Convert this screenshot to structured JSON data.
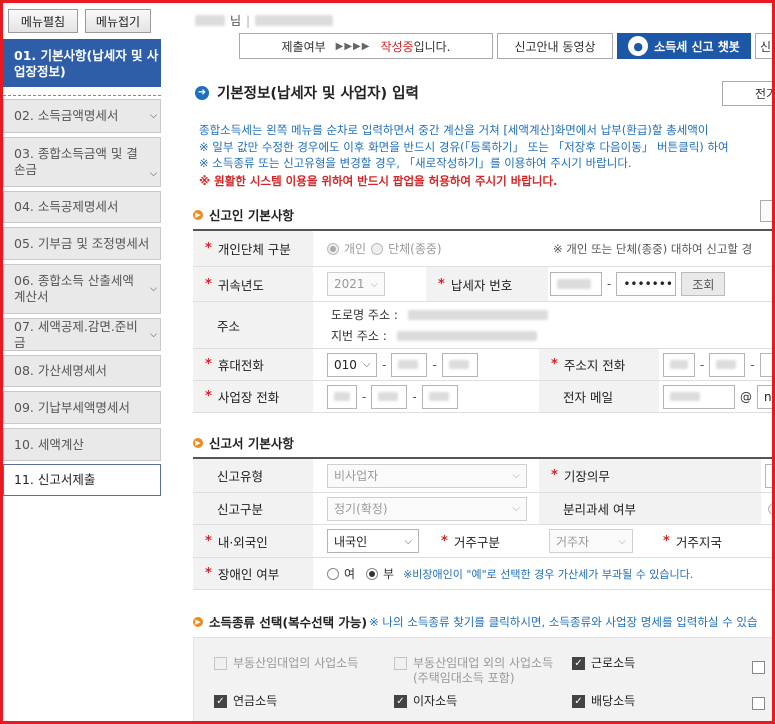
{
  "sidebar": {
    "expand_label": "메뉴펼침",
    "collapse_label": "메뉴접기",
    "items": [
      {
        "label": "01. 기본사항(납세자 및 사업장정보)"
      },
      {
        "label": "02. 소득금액명세서"
      },
      {
        "label": "03. 종합소득금액 및 결손금"
      },
      {
        "label": "04. 소득공제명세서"
      },
      {
        "label": "05. 기부금 및 조정명세서"
      },
      {
        "label": "06. 종합소득 산출세액계산서"
      },
      {
        "label": "07. 세액공제.감면.준비금"
      },
      {
        "label": "08. 가산세명세서"
      },
      {
        "label": "09. 기납부세액명세서"
      },
      {
        "label": "10. 세액계산"
      },
      {
        "label": "11. 신고서제출"
      }
    ]
  },
  "header": {
    "user_suffix": "님",
    "separator": "|",
    "status_label": "제출여부",
    "status_arrows": "▶▶▶▶",
    "status_value": "작성중",
    "status_suffix": "입니다.",
    "guide_video": "신고안내 동영상",
    "chatbot": "소득세 신고 챗봇",
    "extra_tab": "신"
  },
  "page": {
    "title": "기본정보(납세자 및 사업자) 입력",
    "btn_full": "전기"
  },
  "info": {
    "line1": "종합소득세는 왼쪽 메뉴를 순차로 입력하면서 중간 계산을 거쳐 [세액계산]화면에서 납부(환급)할 총세액이",
    "line2": "※ 일부 값만 수정한 경우에도 이후 화면을 반드시 경유(「등록하기」 또는 「저장후 다음이동」 버튼클릭) 하여",
    "line3": "※ 소득종류 또는 신고유형을 변경할 경우, 「새로작성하기」를 이용하여 주시기 바랍니다.",
    "warn": "※ 원활한 시스템 이용을 위하여 반드시 팝업을 허용하여 주시기 바랍니다."
  },
  "reporter": {
    "title": "신고인 기본사항",
    "type_label": "개인단체 구분",
    "type_opt1": "개인",
    "type_opt2": "단체(종중)",
    "type_note": "※ 개인 또는 단체(종중) 대하여 신고할 경",
    "year_label": "귀속년도",
    "year_value": "2021",
    "taxpayer_no_label": "납세자 번호",
    "taxpayer_no_mask": "•••••••",
    "lookup_btn": "조회",
    "address_label": "주소",
    "road_addr_label": "도로명 주소 :",
    "lot_addr_label": "지번 주소 :",
    "mobile_label": "휴대전화",
    "mobile_prefix": "010",
    "home_phone_label": "주소지 전화",
    "biz_phone_label": "사업장 전화",
    "email_label": "전자 메일",
    "email_at": "@",
    "email_domain": "na"
  },
  "filing": {
    "title": "신고서 기본사항",
    "type_label": "신고유형",
    "type_value": "비사업자",
    "bookkeeping_label": "기장의무",
    "category_label": "신고구분",
    "category_value": "정기(확정)",
    "separate_tax_label": "분리과세 여부",
    "nationality_label": "내·외국인",
    "nationality_value": "내국인",
    "residence_label": "거주구분",
    "residence_value": "거주자",
    "residence_region_label": "거주지국",
    "disabled_label": "장애인 여부",
    "disabled_yes": "여",
    "disabled_no": "부",
    "disabled_note": "※비장애인이 \"예\"로 선택한 경우 가산세가 부과될 수 있습니다."
  },
  "income": {
    "title": "소득종류 선택(복수선택 가능)",
    "note": "※ 나의 소득종류 찾기를 클릭하시면, 소득종류와 사업장 명세를 입력하실 수 있습",
    "options": [
      {
        "label": "부동산임대업의 사업소득",
        "checked": false,
        "disabled": true
      },
      {
        "label": "부동산임대업 외의 사업소득",
        "sub": "(주택임대소득 포함)",
        "checked": false,
        "disabled": true
      },
      {
        "label": "근로소득",
        "checked": true,
        "disabled": false
      },
      {
        "label": "연금소득",
        "checked": true,
        "disabled": false
      },
      {
        "label": "이자소득",
        "checked": true,
        "disabled": false
      },
      {
        "label": "배당소득",
        "checked": true,
        "disabled": false
      }
    ]
  },
  "colors": {
    "frame": "#e8191f",
    "sidebar_active": "#2f5ea8",
    "chatbot": "#1d57a8",
    "info_blue": "#1f6fb8",
    "warn_red": "#d42626",
    "section_icon": "#f08a1c"
  }
}
